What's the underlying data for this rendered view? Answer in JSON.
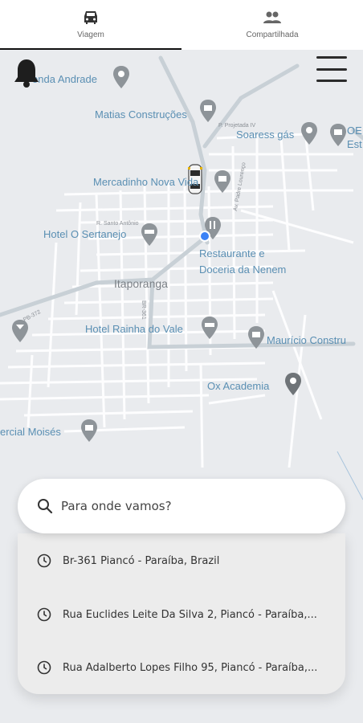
{
  "tabs": [
    {
      "label": "Viagem",
      "icon": "car-icon",
      "active": true
    },
    {
      "label": "Compartilhada",
      "icon": "group-icon",
      "active": false
    }
  ],
  "map": {
    "labels": {
      "fonda_andrade": "onda Andrade",
      "matias": "Matias Construções",
      "projetada": "P. Projetada IV",
      "soaress": "Soaress gás",
      "oe": "OE",
      "est": "Est",
      "mercadinho": "Mercadinho Nova Vida",
      "santo_antonio": "R. Santo Antônio",
      "padre_lourenco": "Av. Padre Lourenço",
      "hotel_sertanejo": "Hotel O Sertanejo",
      "restaurante_1": "Restaurante e",
      "restaurante_2": "Doceria da Nenem",
      "itaporanga": "Itaporanga",
      "br": "BR-361",
      "pb": "PB-372",
      "hotel_rainha": "Hotel Rainha do Vale",
      "mauricelio": "Maurício Constru",
      "ox": "Ox Academia",
      "comercial": "ercial Moisés"
    }
  },
  "search": {
    "placeholder": "Para onde vamos?",
    "icon": "search-icon"
  },
  "recent_places": [
    {
      "icon": "clock-icon",
      "text": "Br-361 Piancó - Paraíba, Brazil"
    },
    {
      "icon": "clock-icon",
      "text": "Rua Euclides Leite Da Silva 2, Piancó - Paraíba,..."
    },
    {
      "icon": "clock-icon",
      "text": "Rua Adalberto Lopes Filho 95, Piancó - Paraíba,..."
    }
  ],
  "colors": {
    "map_bg": "#e9ebee",
    "road": "#ffffff",
    "highway": "#c6cfd6",
    "poi": "#8e9499",
    "label": "#5a8fb3",
    "user_location": "#3b82f6"
  }
}
